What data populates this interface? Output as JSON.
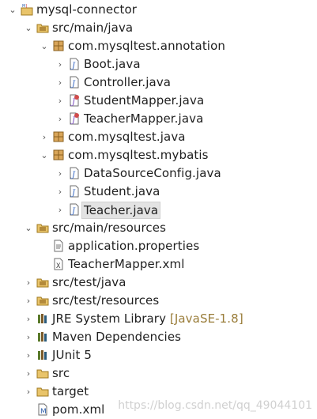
{
  "tree": [
    {
      "label": "mysql-connector",
      "icon": "maven-project-icon",
      "toggle": "expanded",
      "indent": 0
    },
    {
      "label": "src/main/java",
      "icon": "source-folder-icon",
      "toggle": "expanded",
      "indent": 1
    },
    {
      "label": "com.mysqltest.annotation",
      "icon": "package-icon",
      "toggle": "expanded",
      "indent": 2
    },
    {
      "label": "Boot.java",
      "icon": "java-file-icon",
      "toggle": "collapsed",
      "indent": 3
    },
    {
      "label": "Controller.java",
      "icon": "java-file-icon",
      "toggle": "collapsed",
      "indent": 3
    },
    {
      "label": "StudentMapper.java",
      "icon": "java-interface-icon",
      "toggle": "collapsed",
      "indent": 3
    },
    {
      "label": "TeacherMapper.java",
      "icon": "java-interface-icon",
      "toggle": "collapsed",
      "indent": 3
    },
    {
      "label": "com.mysqltest.java",
      "icon": "package-icon",
      "toggle": "collapsed",
      "indent": 2
    },
    {
      "label": "com.mysqltest.mybatis",
      "icon": "package-icon",
      "toggle": "expanded",
      "indent": 2
    },
    {
      "label": "DataSourceConfig.java",
      "icon": "java-file-icon",
      "toggle": "collapsed",
      "indent": 3
    },
    {
      "label": "Student.java",
      "icon": "java-file-icon",
      "toggle": "collapsed",
      "indent": 3
    },
    {
      "label": "Teacher.java",
      "icon": "java-file-icon",
      "toggle": "collapsed",
      "indent": 3,
      "selected": true
    },
    {
      "label": "src/main/resources",
      "icon": "source-folder-icon",
      "toggle": "expanded",
      "indent": 1
    },
    {
      "label": "application.properties",
      "icon": "properties-file-icon",
      "toggle": "none",
      "indent": 2
    },
    {
      "label": "TeacherMapper.xml",
      "icon": "xml-file-icon",
      "toggle": "none",
      "indent": 2
    },
    {
      "label": "src/test/java",
      "icon": "source-folder-icon",
      "toggle": "collapsed",
      "indent": 1
    },
    {
      "label": "src/test/resources",
      "icon": "source-folder-icon",
      "toggle": "collapsed",
      "indent": 1
    },
    {
      "label": "JRE System Library",
      "decoration": "[JavaSE-1.8]",
      "icon": "library-icon",
      "toggle": "collapsed",
      "indent": 1
    },
    {
      "label": "Maven Dependencies",
      "icon": "library-icon",
      "toggle": "collapsed",
      "indent": 1
    },
    {
      "label": "JUnit 5",
      "icon": "library-icon",
      "toggle": "collapsed",
      "indent": 1
    },
    {
      "label": "src",
      "icon": "folder-icon",
      "toggle": "collapsed",
      "indent": 1
    },
    {
      "label": "target",
      "icon": "folder-icon",
      "toggle": "collapsed",
      "indent": 1
    },
    {
      "label": "pom.xml",
      "icon": "maven-pom-icon",
      "toggle": "none",
      "indent": 1
    }
  ],
  "watermark": "https://blog.csdn.net/qq_49044101",
  "colors": {
    "selection": "#e3e3e3",
    "decoration": "#9a7d3a",
    "package": "#b38a3b",
    "java": "#3b6bc4"
  }
}
